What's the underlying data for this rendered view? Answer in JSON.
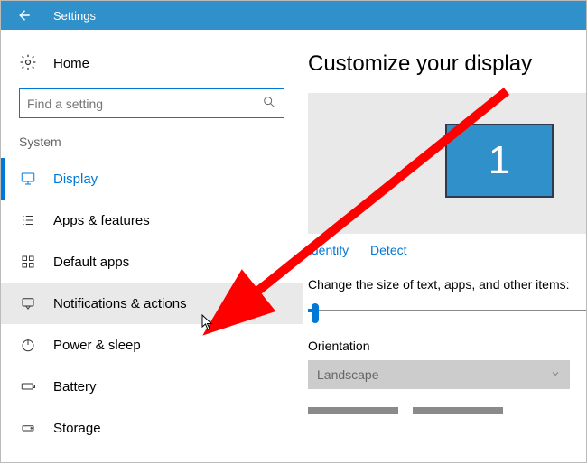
{
  "titlebar": {
    "title": "Settings"
  },
  "sidebar": {
    "home_label": "Home",
    "search_placeholder": "Find a setting",
    "group_label": "System",
    "items": [
      {
        "label": "Display"
      },
      {
        "label": "Apps & features"
      },
      {
        "label": "Default apps"
      },
      {
        "label": "Notifications & actions"
      },
      {
        "label": "Power & sleep"
      },
      {
        "label": "Battery"
      },
      {
        "label": "Storage"
      }
    ]
  },
  "main": {
    "heading": "Customize your display",
    "monitor_number": "1",
    "identify_label": "Identify",
    "detect_label": "Detect",
    "size_text": "Change the size of text, apps, and other items:",
    "orientation_label": "Orientation",
    "orientation_value": "Landscape"
  }
}
